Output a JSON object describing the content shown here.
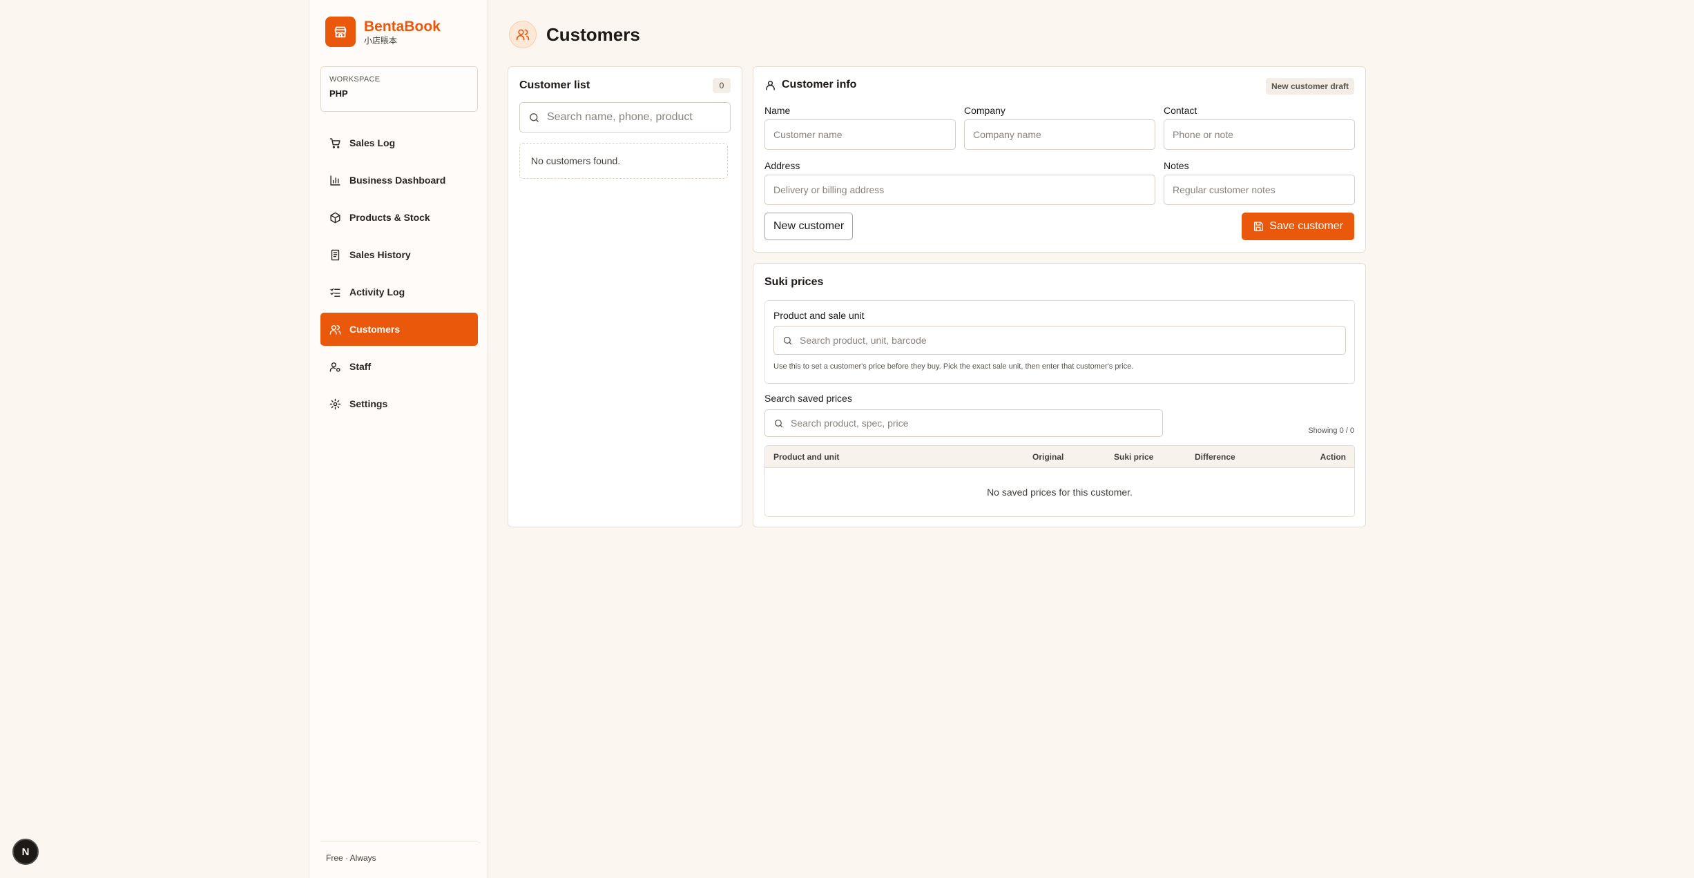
{
  "brand": {
    "name": "BentaBook",
    "subtitle": "小店賬本"
  },
  "workspace": {
    "label": "WORKSPACE",
    "value": "PHP"
  },
  "nav": {
    "items": [
      {
        "label": "Sales Log",
        "icon": "cart-icon",
        "active": false
      },
      {
        "label": "Business Dashboard",
        "icon": "bar-chart-icon",
        "active": false
      },
      {
        "label": "Products & Stock",
        "icon": "package-icon",
        "active": false
      },
      {
        "label": "Sales History",
        "icon": "receipt-icon",
        "active": false
      },
      {
        "label": "Activity Log",
        "icon": "checklist-icon",
        "active": false
      },
      {
        "label": "Customers",
        "icon": "users-icon",
        "active": true
      },
      {
        "label": "Staff",
        "icon": "user-gear-icon",
        "active": false
      },
      {
        "label": "Settings",
        "icon": "gear-icon",
        "active": false
      }
    ]
  },
  "sidebar_footer": "Free · Always",
  "page": {
    "title": "Customers"
  },
  "customer_list": {
    "title": "Customer list",
    "count": "0",
    "search_placeholder": "Search name, phone, product",
    "empty_text": "No customers found."
  },
  "customer_info": {
    "title": "Customer info",
    "badge": "New customer draft",
    "fields": {
      "name": {
        "label": "Name",
        "placeholder": "Customer name",
        "value": ""
      },
      "company": {
        "label": "Company",
        "placeholder": "Company name",
        "value": ""
      },
      "contact": {
        "label": "Contact",
        "placeholder": "Phone or note",
        "value": ""
      },
      "address": {
        "label": "Address",
        "placeholder": "Delivery or billing address",
        "value": ""
      },
      "notes": {
        "label": "Notes",
        "placeholder": "Regular customer notes",
        "value": ""
      }
    },
    "new_button": "New customer",
    "save_button": "Save customer"
  },
  "suki_prices": {
    "title": "Suki prices",
    "product_label": "Product and sale unit",
    "product_placeholder": "Search product, unit, barcode",
    "hint": "Use this to set a customer's price before they buy. Pick the exact sale unit, then enter that customer's price.",
    "saved_label": "Search saved prices",
    "saved_placeholder": "Search product, spec, price",
    "showing": "Showing 0 / 0",
    "columns": [
      "Product and unit",
      "Original",
      "Suki price",
      "Difference",
      "Action"
    ],
    "empty_text": "No saved prices for this customer."
  },
  "colors": {
    "accent": "#ea580c",
    "background": "#fcf6f1"
  }
}
